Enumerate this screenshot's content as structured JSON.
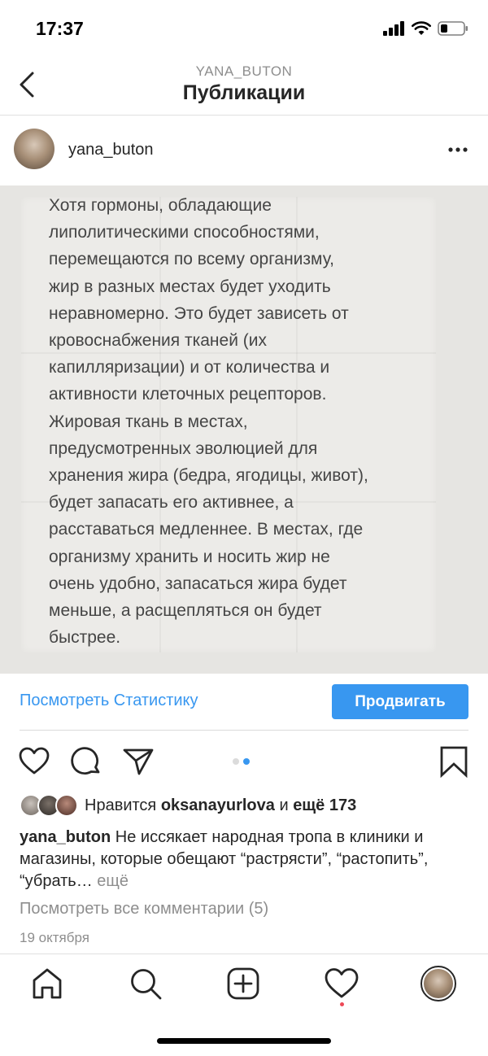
{
  "status_bar": {
    "time": "17:37"
  },
  "header": {
    "subtitle": "YANA_BUTON",
    "title": "Публикации"
  },
  "post": {
    "username": "yana_buton",
    "image_text": "Хотя гормоны, обладающие\nлиполитическими способностями,\nперемещаются по всему организму,\nжир в разных местах будет уходить\nнеравномерно. Это будет зависеть от\nкровоснабжения тканей (их\nкапилляризации) и от количества и\nактивности клеточных рецепторов.\nЖировая ткань в местах,\nпредусмотренных эволюцией для\nхранения жира (бедра, ягодицы, живот),\nбудет запасать его активнее, а\nрасставаться медленнее. В местах, где\nорганизму хранить и носить жир не\nочень удобно, запасаться жира будет\nменьше, а расщепляться он будет\nбыстрее.",
    "carousel": {
      "count": 2,
      "active_index": 2
    }
  },
  "insights": {
    "view_stats_label": "Посмотреть Статистику",
    "promote_label": "Продвигать"
  },
  "likes": {
    "prefix": "Нравится ",
    "liker": "oksanayurlova",
    "connector": " и ",
    "others": "ещё 173"
  },
  "caption": {
    "username": "yana_buton",
    "text": " Не иссякает народная тропа в клиники и магазины, которые обещают “растрясти”, “растопить”, “убрать…",
    "more_label": " ещё"
  },
  "comments_link": "Посмотреть все комментарии (5)",
  "date": "19 октября",
  "icons": {
    "back": "chevron-left-icon",
    "more": "more-horizontal-icon",
    "like": "heart-icon",
    "comment": "comment-icon",
    "share": "send-icon",
    "save": "bookmark-icon"
  },
  "colors": {
    "accent": "#3897f0",
    "text": "#262626",
    "muted": "#8e8e8e",
    "notification": "#ed4956"
  }
}
